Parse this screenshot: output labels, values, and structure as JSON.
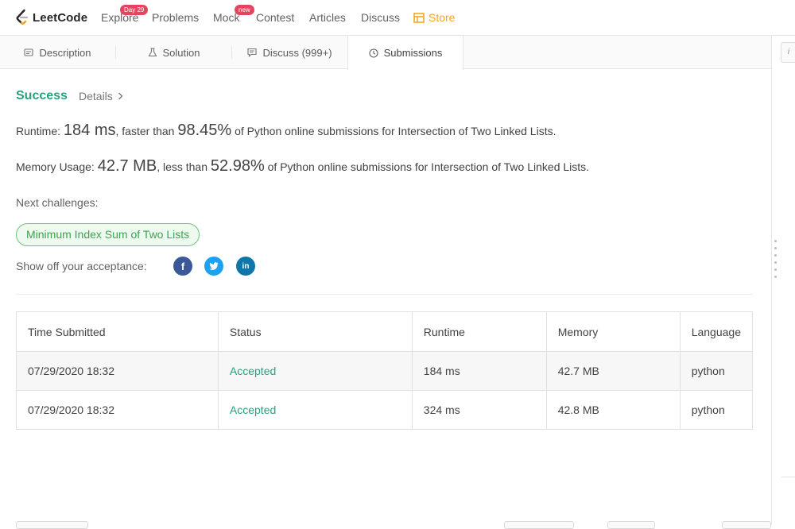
{
  "nav": {
    "logo_text": "LeetCode",
    "items": [
      {
        "label": "Explore",
        "badge": "Day 29"
      },
      {
        "label": "Problems"
      },
      {
        "label": "Mock",
        "badge": "new"
      },
      {
        "label": "Contest"
      },
      {
        "label": "Articles"
      },
      {
        "label": "Discuss"
      },
      {
        "label": "Store"
      }
    ]
  },
  "tabs": [
    {
      "label": "Description",
      "icon": "description-icon"
    },
    {
      "label": "Solution",
      "icon": "flask-icon"
    },
    {
      "label": "Discuss (999+)",
      "icon": "comment-icon"
    },
    {
      "label": "Submissions",
      "icon": "clock-icon",
      "active": true
    }
  ],
  "result": {
    "status": "Success",
    "details_label": "Details",
    "runtime": {
      "label": "Runtime:",
      "value": "184 ms",
      "compare": ", faster than",
      "percent": "98.45%",
      "suffix": "of Python online submissions for Intersection of Two Linked Lists."
    },
    "memory": {
      "label": "Memory Usage:",
      "value": "42.7 MB",
      "compare": ", less than",
      "percent": "52.98%",
      "suffix": "of Python online submissions for Intersection of Two Linked Lists."
    },
    "next_label": "Next challenges:",
    "next_challenge": "Minimum Index Sum of Two Lists",
    "showoff_label": "Show off your acceptance:",
    "social": [
      "facebook-icon",
      "twitter-icon",
      "linkedin-icon"
    ]
  },
  "table": {
    "headers": [
      "Time Submitted",
      "Status",
      "Runtime",
      "Memory",
      "Language"
    ],
    "rows": [
      [
        "07/29/2020 18:32",
        "Accepted",
        "184 ms",
        "42.7 MB",
        "python"
      ],
      [
        "07/29/2020 18:32",
        "Accepted",
        "324 ms",
        "42.8 MB",
        "python"
      ]
    ]
  },
  "side": {
    "info_label": "i"
  },
  "colors": {
    "accent": "#26a27e",
    "store": "#f5a623",
    "badge": "#e4445e"
  }
}
